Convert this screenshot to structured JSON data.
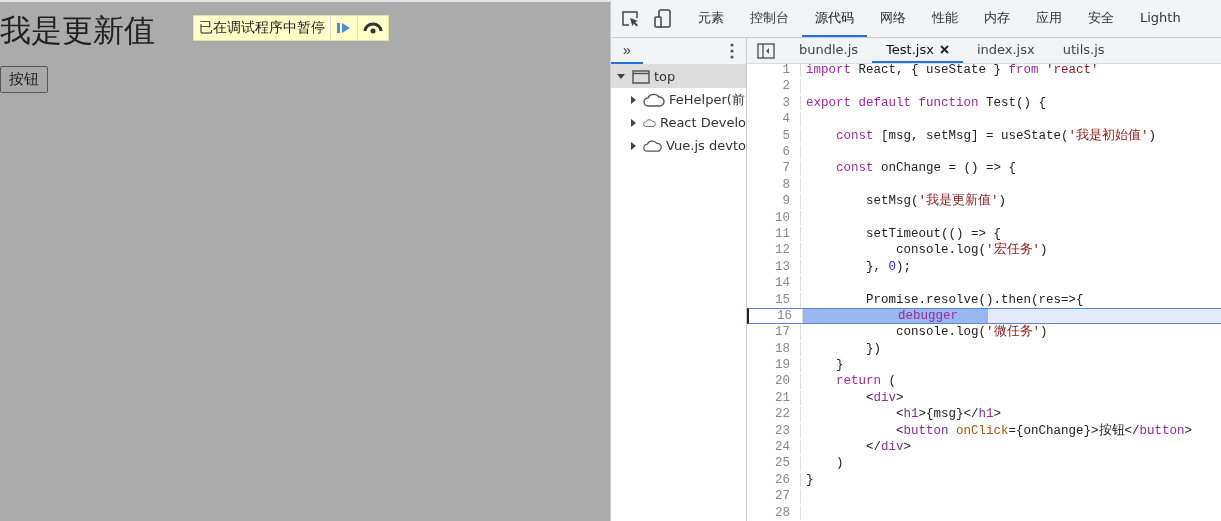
{
  "page": {
    "heading": "我是更新值",
    "button": "按钮"
  },
  "paused_overlay": {
    "message": "已在调试程序中暂停"
  },
  "devtools": {
    "tabs": [
      {
        "label": "元素",
        "selected": false
      },
      {
        "label": "控制台",
        "selected": false
      },
      {
        "label": "源代码",
        "selected": true
      },
      {
        "label": "网络",
        "selected": false
      },
      {
        "label": "性能",
        "selected": false
      },
      {
        "label": "内存",
        "selected": false
      },
      {
        "label": "应用",
        "selected": false
      },
      {
        "label": "安全",
        "selected": false
      },
      {
        "label": "Lighth",
        "selected": false
      }
    ],
    "sidebar": {
      "more": "»",
      "tree": [
        {
          "label": "top",
          "expanded": true,
          "selected": true,
          "children": [
            {
              "label": "FeHelper(前",
              "expanded": false,
              "selected": false
            },
            {
              "label": "React Develo",
              "expanded": false,
              "selected": false
            },
            {
              "label": "Vue.js devto",
              "expanded": false,
              "selected": false
            }
          ]
        }
      ]
    },
    "editor_tabs": [
      {
        "label": "bundle.js",
        "selected": false
      },
      {
        "label": "Test.jsx",
        "selected": true
      },
      {
        "label": "index.jsx",
        "selected": false
      },
      {
        "label": "utils.js",
        "selected": false
      }
    ],
    "code": [
      {
        "number": "1",
        "paused": false,
        "tokens": [
          {
            "kind": "keyword",
            "text": "import"
          },
          {
            "kind": "plain",
            "text": " React, { useState } "
          },
          {
            "kind": "keyword",
            "text": "from "
          },
          {
            "kind": "string",
            "text": "'react'"
          }
        ]
      },
      {
        "number": "2",
        "paused": false
      },
      {
        "number": "3",
        "paused": false,
        "tokens": [
          {
            "kind": "keyword",
            "text": "export default function"
          },
          {
            "kind": "plain",
            "text": " Test() {"
          }
        ]
      },
      {
        "number": "4",
        "paused": false
      },
      {
        "number": "5",
        "paused": false,
        "tokens": [
          {
            "kind": "keyword",
            "text": "    const"
          },
          {
            "kind": "plain",
            "text": " [msg, setMsg] = useState("
          },
          {
            "kind": "string",
            "text": "'我是初始值'"
          },
          {
            "kind": "plain",
            "text": ")"
          }
        ]
      },
      {
        "number": "6",
        "paused": false
      },
      {
        "number": "7",
        "paused": false,
        "tokens": [
          {
            "kind": "keyword",
            "text": "    const"
          },
          {
            "kind": "plain",
            "text": " onChange = () => {"
          }
        ]
      },
      {
        "number": "8",
        "paused": false
      },
      {
        "number": "9",
        "paused": false,
        "tokens": [
          {
            "kind": "plain",
            "text": "        setMsg("
          },
          {
            "kind": "string",
            "text": "'我是更新值'"
          },
          {
            "kind": "plain",
            "text": ")"
          }
        ]
      },
      {
        "number": "10",
        "paused": false
      },
      {
        "number": "11",
        "paused": false,
        "tokens": [
          {
            "kind": "plain",
            "text": "        setTimeout(() => {"
          }
        ]
      },
      {
        "number": "12",
        "paused": false,
        "tokens": [
          {
            "kind": "plain",
            "text": "            console.log("
          },
          {
            "kind": "string",
            "text": "'宏任务'"
          },
          {
            "kind": "plain",
            "text": ")"
          }
        ]
      },
      {
        "number": "13",
        "paused": false,
        "tokens": [
          {
            "kind": "plain",
            "text": "        }, "
          },
          {
            "kind": "number",
            "text": "0"
          },
          {
            "kind": "plain",
            "text": ");"
          }
        ]
      },
      {
        "number": "14",
        "paused": false
      },
      {
        "number": "15",
        "paused": false,
        "tokens": [
          {
            "kind": "plain",
            "text": "        Promise.resolve().then(res=>{"
          }
        ]
      },
      {
        "number": "16",
        "paused": true,
        "tokens": [
          {
            "kind": "keyword",
            "text": "            debugger"
          }
        ]
      },
      {
        "number": "17",
        "paused": false,
        "tokens": [
          {
            "kind": "plain",
            "text": "            console.log("
          },
          {
            "kind": "string",
            "text": "'微任务'"
          },
          {
            "kind": "plain",
            "text": ")"
          }
        ]
      },
      {
        "number": "18",
        "paused": false,
        "tokens": [
          {
            "kind": "plain",
            "text": "        })"
          }
        ]
      },
      {
        "number": "19",
        "paused": false,
        "tokens": [
          {
            "kind": "plain",
            "text": "    }"
          }
        ]
      },
      {
        "number": "20",
        "paused": false,
        "tokens": [
          {
            "kind": "keyword",
            "text": "    return"
          },
          {
            "kind": "plain",
            "text": " ("
          }
        ]
      },
      {
        "number": "21",
        "paused": false,
        "tokens": [
          {
            "kind": "plain",
            "text": "        <"
          },
          {
            "kind": "tag",
            "text": "div"
          },
          {
            "kind": "plain",
            "text": ">"
          }
        ]
      },
      {
        "number": "22",
        "paused": false,
        "tokens": [
          {
            "kind": "plain",
            "text": "            <"
          },
          {
            "kind": "tag",
            "text": "h1"
          },
          {
            "kind": "plain",
            "text": ">{msg}</"
          },
          {
            "kind": "tag",
            "text": "h1"
          },
          {
            "kind": "plain",
            "text": ">"
          }
        ]
      },
      {
        "number": "23",
        "paused": false,
        "tokens": [
          {
            "kind": "plain",
            "text": "            <"
          },
          {
            "kind": "tag",
            "text": "button"
          },
          {
            "kind": "attr",
            "text": " onClick"
          },
          {
            "kind": "plain",
            "text": "={onChange}>按钮</"
          },
          {
            "kind": "tag",
            "text": "button"
          },
          {
            "kind": "plain",
            "text": ">"
          }
        ]
      },
      {
        "number": "24",
        "paused": false,
        "tokens": [
          {
            "kind": "plain",
            "text": "        </"
          },
          {
            "kind": "tag",
            "text": "div"
          },
          {
            "kind": "plain",
            "text": ">"
          }
        ]
      },
      {
        "number": "25",
        "paused": false,
        "tokens": [
          {
            "kind": "plain",
            "text": "    )"
          }
        ]
      },
      {
        "number": "26",
        "paused": false,
        "tokens": [
          {
            "kind": "plain",
            "text": "}"
          }
        ]
      },
      {
        "number": "27",
        "paused": false
      },
      {
        "number": "28",
        "paused": false
      }
    ]
  }
}
